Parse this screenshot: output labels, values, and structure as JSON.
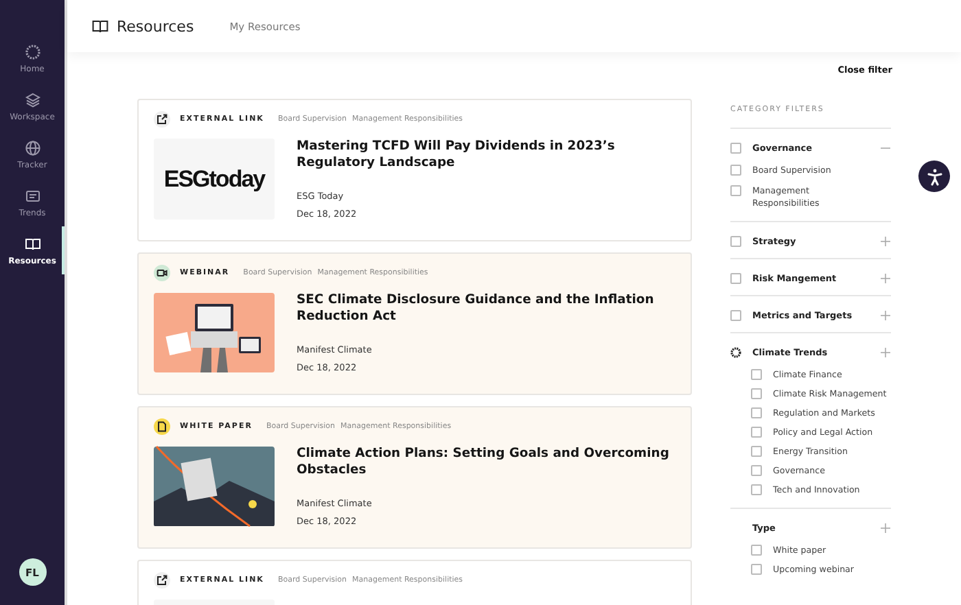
{
  "sidebar": {
    "items": [
      {
        "label": "Home",
        "kind": "home",
        "selected": false
      },
      {
        "label": "Workspace",
        "kind": "workspace",
        "selected": false
      },
      {
        "label": "Tracker",
        "kind": "tracker",
        "selected": false
      },
      {
        "label": "Trends",
        "kind": "trends",
        "selected": false
      },
      {
        "label": "Resources",
        "kind": "resources",
        "selected": true
      }
    ],
    "avatar": "FL"
  },
  "header": {
    "title": "Resources",
    "tabs": [
      {
        "label": "My Resources",
        "selected": false
      }
    ]
  },
  "close_filter": "Close filter",
  "cards": [
    {
      "kind": "external_link",
      "type_label": "EXTERNAL LINK",
      "tags": [
        "Board Supervision",
        "Management Responsibilities"
      ],
      "thumbnail": {
        "kind": "logo",
        "text": "ESGtoday"
      },
      "title": "Mastering TCFD Will Pay Dividends in 2023’s Regulatory Landscape",
      "source": "ESG Today",
      "date": "Dec 18, 2022"
    },
    {
      "kind": "webinar",
      "type_label": "WEBINAR",
      "tags": [
        "Board Supervision",
        "Management Responsibilities"
      ],
      "thumbnail": {
        "kind": "illustration"
      },
      "title": "SEC Climate Disclosure Guidance and the Inflation Reduction Act",
      "source": "Manifest Climate",
      "date": "Dec 18, 2022"
    },
    {
      "kind": "white_paper",
      "type_label": "WHITE PAPER",
      "tags": [
        "Board Supervision",
        "Management Responsibilities"
      ],
      "thumbnail": {
        "kind": "photo"
      },
      "title": "Climate Action Plans: Setting Goals and Overcoming Obstacles",
      "source": "Manifest Climate",
      "date": "Dec 18, 2022"
    },
    {
      "kind": "external_link",
      "type_label": "EXTERNAL LINK",
      "tags": [
        "Board Supervision",
        "Management Responsibilities"
      ],
      "thumbnail": {
        "kind": "blank"
      }
    }
  ],
  "filters": {
    "heading": "CATEGORY FILTERS",
    "groups": [
      {
        "kind": "checkbox",
        "label": "Governance",
        "expanded": true,
        "checked": false,
        "children": [
          {
            "label": "Board Supervision",
            "checked": false
          },
          {
            "label": "Management Responsibilities",
            "checked": false
          }
        ]
      },
      {
        "kind": "checkbox",
        "label": "Strategy",
        "expanded": false,
        "checked": false
      },
      {
        "kind": "checkbox",
        "label": "Risk Mangement",
        "expanded": false,
        "checked": false
      },
      {
        "kind": "checkbox",
        "label": "Metrics and Targets",
        "expanded": false,
        "checked": false
      },
      {
        "kind": "loading",
        "label": "Climate Trends",
        "expanded": false,
        "children": [
          {
            "label": "Climate Finance",
            "checked": false
          },
          {
            "label": "Climate Risk Management",
            "checked": false
          },
          {
            "label": "Regulation and Markets",
            "checked": false
          },
          {
            "label": "Policy and Legal Action",
            "checked": false
          },
          {
            "label": "Energy Transition",
            "checked": false
          },
          {
            "label": "Governance",
            "checked": false
          },
          {
            "label": "Tech and Innovation",
            "checked": false
          }
        ]
      },
      {
        "kind": "plain",
        "label": "Type",
        "expanded": false,
        "children": [
          {
            "label": "White paper",
            "checked": false
          },
          {
            "label": "Upcoming webinar",
            "checked": false
          }
        ]
      }
    ]
  }
}
